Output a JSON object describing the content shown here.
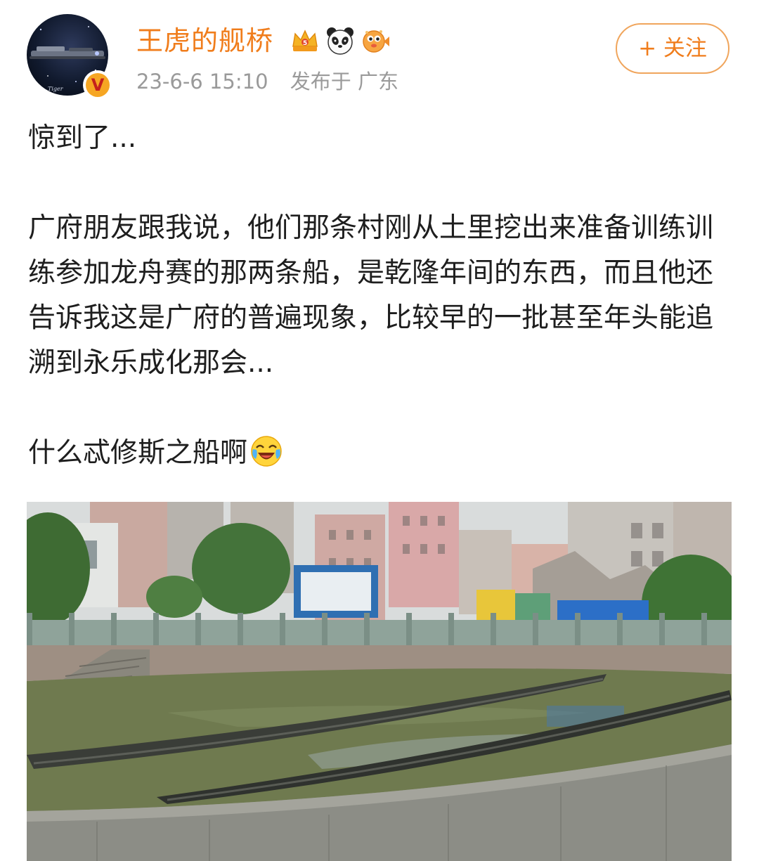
{
  "post": {
    "author": {
      "name": "王虎的舰桥",
      "badges": [
        "crown-badge-icon",
        "panda-badge-icon",
        "pufferfish-badge-icon"
      ],
      "verified_mark": "V"
    },
    "time": "23-6-6 15:10",
    "location": "发布于 广东",
    "follow_label": "+ 关注",
    "paragraphs": [
      "惊到了...",
      "广府朋友跟我说，他们那条村刚从土里挖出来准备训练训练参加龙舟赛的那两条船，是乾隆年间的东西，而且他还告诉我这是广府的普遍现象，比较早的一批甚至年头能追溯到永乐成化那会...",
      "什么忒修斯之船啊"
    ],
    "trailing_emoji": "laughing-crying-emoji-icon",
    "image": {
      "subject": "photo-of-two-dragon-boats-in-pond"
    }
  },
  "colors": {
    "accent": "#f07d1c",
    "meta_text": "#9a9a9a",
    "body_text": "#1e1e1e",
    "follow_border": "#f0a55c"
  }
}
